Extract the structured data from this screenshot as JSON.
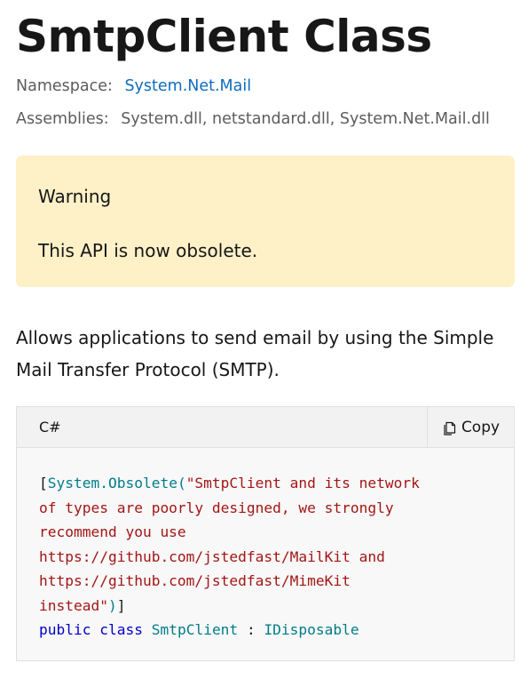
{
  "header": {
    "title": "SmtpClient Class"
  },
  "meta": {
    "namespace_label": "Namespace:",
    "namespace_value": "System.Net.Mail",
    "assemblies_label": "Assemblies:",
    "assemblies_value": "System.dll, netstandard.dll, System.Net.Mail.dll"
  },
  "alert": {
    "title": "Warning",
    "body": "This API is now obsolete.",
    "background_color": "#fef0c7"
  },
  "description": "Allows applications to send email by using the Simple Mail Transfer Protocol (SMTP).",
  "code": {
    "language": "C#",
    "copy_label": "Copy",
    "copy_icon": "copy-icon",
    "tokens": {
      "open_bracket": "[",
      "attribute_name": "System.Obsolete",
      "open_paren": "(",
      "string_line_1": "\"SmtpClient and its network",
      "string_line_2": "of types are poorly designed, we strongly",
      "string_line_3": "recommend you use",
      "string_line_4": "https://github.com/jstedfast/MailKit and",
      "string_line_5": "https://github.com/jstedfast/MimeKit",
      "string_line_6": "instead\"",
      "close_paren": ")",
      "close_bracket": "]",
      "kw_public": "public",
      "kw_class": "class",
      "class_name": "SmtpClient",
      "colon": ":",
      "interface_name": "IDisposable"
    }
  },
  "colors": {
    "link": "#0f6cbd",
    "attribute": "#007c89",
    "string": "#a31515",
    "keyword": "#0000c8"
  }
}
